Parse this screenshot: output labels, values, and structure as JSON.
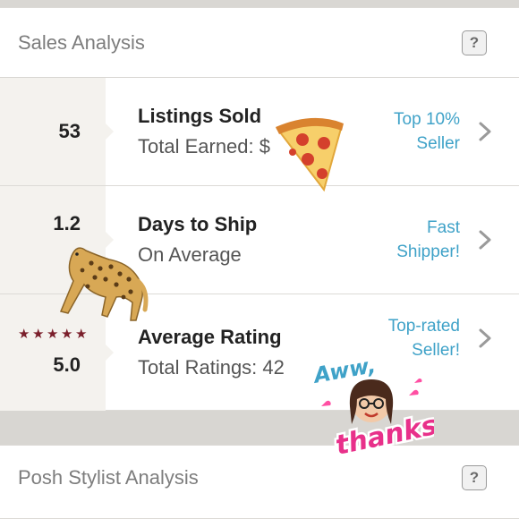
{
  "sales_card": {
    "title": "Sales Analysis",
    "help": "?",
    "rows": [
      {
        "metric": "53",
        "title": "Listings Sold",
        "subtitle": "Total Earned: $",
        "badge_line1": "Top 10%",
        "badge_line2": "Seller"
      },
      {
        "metric": "1.2",
        "title": "Days to Ship",
        "subtitle": "On Average",
        "badge_line1": "Fast",
        "badge_line2": "Shipper!"
      },
      {
        "metric": "5.0",
        "stars": 5,
        "title": "Average Rating",
        "subtitle": "Total Ratings: 42",
        "badge_line1": "Top-rated",
        "badge_line2": "Seller!"
      }
    ]
  },
  "stylist_card": {
    "title": "Posh Stylist Analysis",
    "help": "?"
  },
  "stickers": {
    "thanks_top": "Aww,",
    "thanks_bottom": "thanks"
  },
  "colors": {
    "accent": "#3fa2c8",
    "star": "#7a1f2b",
    "metric_bg": "#f4f2ee",
    "sticker_pink": "#e8308a"
  },
  "icons": [
    "chevron-right-icon",
    "help-icon",
    "star-icon",
    "pizza-sticker",
    "leopard-sticker",
    "thanks-sticker"
  ]
}
